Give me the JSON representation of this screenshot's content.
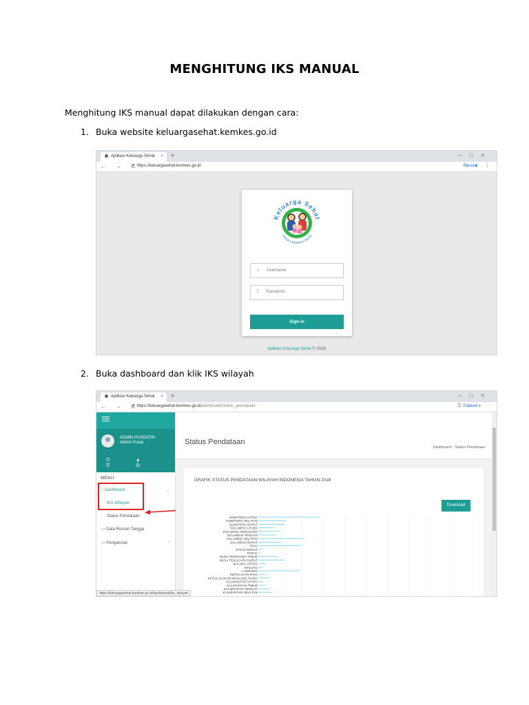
{
  "doc": {
    "title": "MENGHITUNG IKS MANUAL",
    "intro": "Menghitung IKS manual dapat dilakukan dengan cara:",
    "step1_num": "1.",
    "step1_text": "Buka website keluargasehat.kemkes.go.id",
    "step2_num": "2.",
    "step2_text": "Buka dashboard dan klik IKS wilayah"
  },
  "browser1": {
    "tab_title": "Aplikasi Keluarga Sehat",
    "tab_close": "×",
    "new_tab": "+",
    "window_controls": "–□×",
    "nav": "← → C",
    "url": "https://keluargasehat.kemkes.go.id",
    "url_path": "",
    "paused": "Paused",
    "right_icons": "☆ ◐ ⋮"
  },
  "login": {
    "logo_text": "Keluarga Sehat",
    "logo_subtext": "Untuk Indonesia Sehat",
    "username_icon": "♙",
    "username_placeholder": "Username",
    "password_icon": "⚿",
    "password_placeholder": "Password",
    "signin": "Sign in",
    "footer_brand": "Aplikasi Keluarga Sehat",
    "footer_rest": " © 2018"
  },
  "browser2": {
    "tab_title": "Aplikasi Keluarga Sehat",
    "tab_close": "×",
    "new_tab": "+",
    "window_controls": "–□×",
    "nav": "← → C",
    "url": "https://keluargasehat.kemkes.go.id",
    "url_path": "/dashboard/status_pendataan",
    "paused": "Paused",
    "right_icons": "⚿ ☆ ◐ ⋮",
    "status_url": "https://keluargasehat.kemkes.go.id/dashboard/iks_wilayah"
  },
  "dashboard": {
    "user_name": "ADMIN PUSDATIN",
    "user_role": "Admin Pusat",
    "user_icons": "⏻ ♟ ⚿ ⚙",
    "menu_label": "MENU",
    "menu": {
      "dashboard": "Dashboard",
      "iks_wilayah": "IKS Wilayah",
      "status_pendataan": "Status Pendataan",
      "data_rumah_tangga": "Data Rumah Tangga",
      "pengaturan": "Pengaturan"
    },
    "home_icon": "⌂",
    "folder_icon": "▭",
    "chevron_down": "⌄",
    "chevron_right": "›",
    "page_title": "Status Pendataan",
    "breadcrumb": "Dashboard › Status Pendataan",
    "panel_title": "GRAFIK STATUS PENDATAAN WILAYAH INDONESIA TAHUN 2018",
    "download": "Download"
  },
  "colors": {
    "teal": "#1e9d96",
    "teal_dark": "#1b918b",
    "red_highlight": "#e02020",
    "bar": "#7ecfe6"
  },
  "chart_data": {
    "type": "bar",
    "orientation": "horizontal",
    "title": "GRAFIK STATUS PENDATAAN WILAYAH INDONESIA TAHUN 2018",
    "categories": [
      "SUMATERA UTARA",
      "SUMATERA SELATAN",
      "SUMATERA BARAT",
      "SULAWESI UTARA",
      "SULAWESI TENGGARA",
      "SULAWESI TENGAH",
      "SULAWESI SELATAN",
      "SULAWESI BARAT",
      "RIAU",
      "PAPUA BARAT",
      "PAPUA",
      "NUSA TENGGARA TIMUR",
      "NUSA TENGGARA BARAT",
      "MALUKU UTARA",
      "MALUKU",
      "LAMPUNG",
      "KEPULAUAN RIAU",
      "KEPULAUAN BANGKA BELITUNG",
      "KALIMANTAN UTARA",
      "KALIMANTAN TIMUR",
      "KALIMANTAN TENGAH",
      "KALIMANTAN SELATAN"
    ],
    "values": [
      0.28,
      0.13,
      0.12,
      0.07,
      0.1,
      0.08,
      0.21,
      0.1,
      0.19,
      0.02,
      0.01,
      0.09,
      0.12,
      0.03,
      0.02,
      0.19,
      0.03,
      0.05,
      0.02,
      0.03,
      0.05,
      0.06
    ],
    "grid": true
  }
}
